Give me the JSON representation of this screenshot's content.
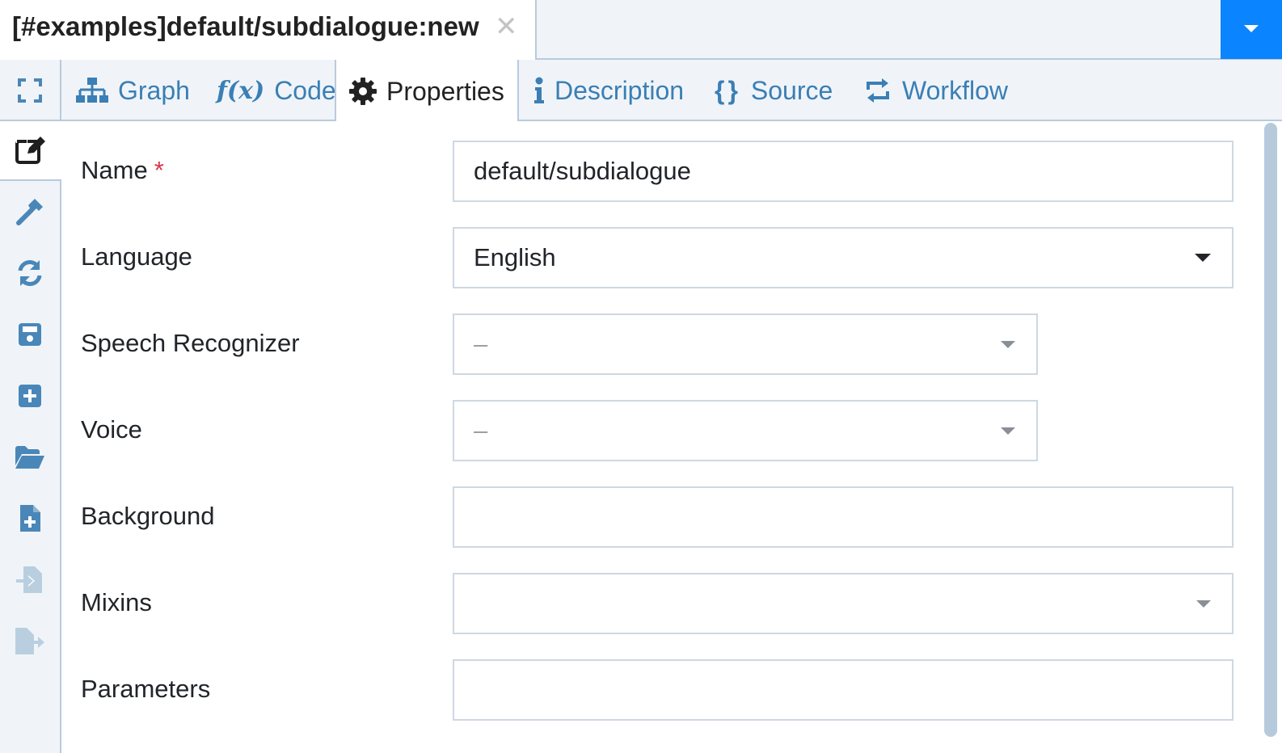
{
  "document_tab": {
    "title": "[#examples]default/subdialogue:new",
    "close_glyph": "✕"
  },
  "colors": {
    "accent": "#0a84ff",
    "link": "#3a7fb5",
    "icon": "#4a87b8",
    "icon_disabled": "#b9cfe0",
    "required": "#dc3545",
    "border": "#b8cbdc"
  },
  "sidebar": {
    "items": [
      {
        "icon": "expand-icon",
        "state": "normal"
      },
      {
        "icon": "edit-icon",
        "state": "active"
      },
      {
        "icon": "hammer-icon",
        "state": "normal"
      },
      {
        "icon": "refresh-icon",
        "state": "normal"
      },
      {
        "icon": "save-icon",
        "state": "normal"
      },
      {
        "icon": "plus-square-icon",
        "state": "normal"
      },
      {
        "icon": "folder-open-icon",
        "state": "normal"
      },
      {
        "icon": "file-add-icon",
        "state": "normal"
      },
      {
        "icon": "file-import-icon",
        "state": "disabled"
      },
      {
        "icon": "file-export-icon",
        "state": "disabled"
      }
    ]
  },
  "view_tabs": [
    {
      "label": "Graph",
      "icon": "sitemap-icon"
    },
    {
      "label": "Code",
      "icon": "function-icon"
    },
    {
      "label": "Properties",
      "icon": "gear-icon",
      "active": true
    },
    {
      "label": "Description",
      "icon": "info-icon"
    },
    {
      "label": "Source",
      "icon": "braces-icon"
    },
    {
      "label": "Workflow",
      "icon": "retweet-icon"
    }
  ],
  "form": {
    "name": {
      "label": "Name",
      "required_mark": "*",
      "value": "default/subdialogue"
    },
    "language": {
      "label": "Language",
      "value": "English"
    },
    "speech_recognizer": {
      "label": "Speech Recognizer",
      "value": "–"
    },
    "voice": {
      "label": "Voice",
      "value": "–"
    },
    "background": {
      "label": "Background",
      "value": ""
    },
    "mixins": {
      "label": "Mixins",
      "value": ""
    },
    "parameters": {
      "label": "Parameters",
      "value": ""
    }
  }
}
